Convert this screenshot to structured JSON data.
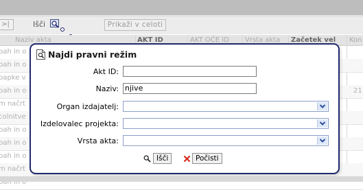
{
  "toolbar": {
    "nav_label": ">|",
    "search_label": "Išči",
    "show_all_label": "Prikaži v celoti"
  },
  "grid": {
    "headers": [
      "Naziv akta",
      "AKT ID",
      "AKT OČE ID",
      "Vrsta akta",
      "Začetek vel",
      "Kon"
    ],
    "rows": [
      {
        "text": "bah in o"
      },
      {
        "text": "bah in o"
      },
      {
        "text": "papke v"
      },
      {
        "text": "bah in o",
        "right": "21"
      },
      {
        "text": "m načrt"
      },
      {
        "text": "colnitve"
      },
      {
        "text": "bah in o"
      },
      {
        "text": "bah in o"
      },
      {
        "text": "bah in o"
      },
      {
        "text": "m načrt"
      },
      {
        "text": "bah in o"
      }
    ]
  },
  "dialog": {
    "title": "Najdi pravni režim",
    "fields": {
      "akt_id": {
        "label": "Akt ID:",
        "value": ""
      },
      "naziv": {
        "label": "Naziv:",
        "value": "njive"
      },
      "organ": {
        "label": "Organ izdajatelj:",
        "value": ""
      },
      "izdelovalec": {
        "label": "Izdelovalec projekta:",
        "value": ""
      },
      "vrsta": {
        "label": "Vrsta akta:",
        "value": ""
      }
    },
    "search_button": "Išči",
    "clear_button": "Počisti"
  },
  "colors": {
    "dialog_border": "#1f2a6e",
    "select_arrow": "#2b4d9a",
    "clear_icon": "#d42a1e"
  }
}
